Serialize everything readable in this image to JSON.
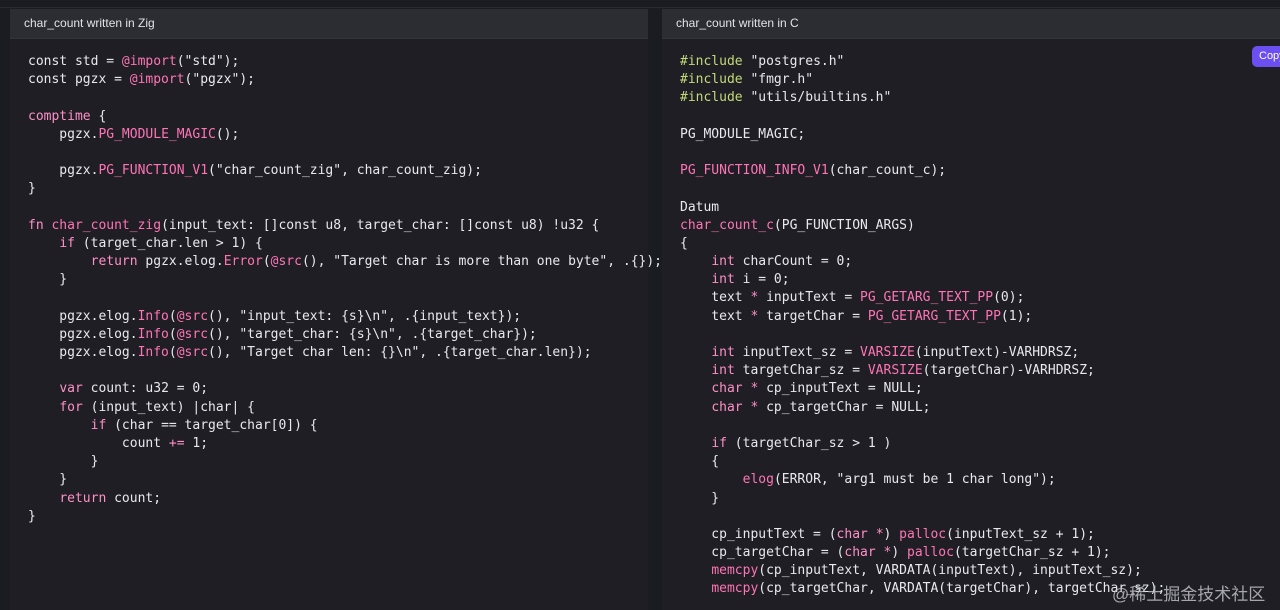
{
  "panels": {
    "zig": {
      "title": "char_count written in Zig",
      "lines": [
        [
          {
            "t": "const std = "
          },
          {
            "t": "@import",
            "c": "fn"
          },
          {
            "t": "(\"std\");"
          }
        ],
        [
          {
            "t": "const pgzx = "
          },
          {
            "t": "@import",
            "c": "fn"
          },
          {
            "t": "(\"pgzx\");"
          }
        ],
        [],
        [
          {
            "t": "comptime",
            "c": "kw"
          },
          {
            "t": " {"
          }
        ],
        [
          {
            "t": "    pgzx."
          },
          {
            "t": "PG_MODULE_MAGIC",
            "c": "fn"
          },
          {
            "t": "();"
          }
        ],
        [],
        [
          {
            "t": "    pgzx."
          },
          {
            "t": "PG_FUNCTION_V1",
            "c": "fn"
          },
          {
            "t": "(\"char_count_zig\", char_count_zig);"
          }
        ],
        [
          {
            "t": "}"
          }
        ],
        [],
        [
          {
            "t": "fn",
            "c": "kw"
          },
          {
            "t": " "
          },
          {
            "t": "char_count_zig",
            "c": "fn"
          },
          {
            "t": "(input_text: []const u8, target_char: []const u8) !u32 {"
          }
        ],
        [
          {
            "t": "    "
          },
          {
            "t": "if",
            "c": "kw"
          },
          {
            "t": " (target_char.len > 1) {"
          }
        ],
        [
          {
            "t": "        "
          },
          {
            "t": "return",
            "c": "kw"
          },
          {
            "t": " pgzx.elog."
          },
          {
            "t": "Error",
            "c": "fn"
          },
          {
            "t": "("
          },
          {
            "t": "@src",
            "c": "fn"
          },
          {
            "t": "(), \"Target char is more than one byte\", .{});"
          }
        ],
        [
          {
            "t": "    }"
          }
        ],
        [],
        [
          {
            "t": "    pgzx.elog."
          },
          {
            "t": "Info",
            "c": "fn"
          },
          {
            "t": "("
          },
          {
            "t": "@src",
            "c": "fn"
          },
          {
            "t": "(), \"input_text: {s}\\n\", .{input_text});"
          }
        ],
        [
          {
            "t": "    pgzx.elog."
          },
          {
            "t": "Info",
            "c": "fn"
          },
          {
            "t": "("
          },
          {
            "t": "@src",
            "c": "fn"
          },
          {
            "t": "(), \"target_char: {s}\\n\", .{target_char});"
          }
        ],
        [
          {
            "t": "    pgzx.elog."
          },
          {
            "t": "Info",
            "c": "fn"
          },
          {
            "t": "("
          },
          {
            "t": "@src",
            "c": "fn"
          },
          {
            "t": "(), \"Target char len: {}\\n\", .{target_char.len});"
          }
        ],
        [],
        [
          {
            "t": "    "
          },
          {
            "t": "var",
            "c": "kw"
          },
          {
            "t": " count: u32 = 0;"
          }
        ],
        [
          {
            "t": "    "
          },
          {
            "t": "for",
            "c": "kw"
          },
          {
            "t": " (input_text) |char| {"
          }
        ],
        [
          {
            "t": "        "
          },
          {
            "t": "if",
            "c": "kw"
          },
          {
            "t": " (char == target_char[0]) {"
          }
        ],
        [
          {
            "t": "            count "
          },
          {
            "t": "+=",
            "c": "op"
          },
          {
            "t": " 1;"
          }
        ],
        [
          {
            "t": "        }"
          }
        ],
        [
          {
            "t": "    }"
          }
        ],
        [
          {
            "t": "    "
          },
          {
            "t": "return",
            "c": "kw"
          },
          {
            "t": " count;"
          }
        ],
        [
          {
            "t": "}"
          }
        ]
      ]
    },
    "c": {
      "title": "char_count written in C",
      "copy_label": "Copy",
      "lines": [
        [
          {
            "t": "#include",
            "c": "pre"
          },
          {
            "t": " \"postgres.h\""
          }
        ],
        [
          {
            "t": "#include",
            "c": "pre"
          },
          {
            "t": " \"fmgr.h\""
          }
        ],
        [
          {
            "t": "#include",
            "c": "pre"
          },
          {
            "t": " \"utils/builtins.h\""
          }
        ],
        [],
        [
          {
            "t": "PG_MODULE_MAGIC;"
          }
        ],
        [],
        [
          {
            "t": "PG_FUNCTION_INFO_V1",
            "c": "fn"
          },
          {
            "t": "(char_count_c);"
          }
        ],
        [],
        [
          {
            "t": "Datum"
          }
        ],
        [
          {
            "t": "char_count_c",
            "c": "fn"
          },
          {
            "t": "(PG_FUNCTION_ARGS)"
          }
        ],
        [
          {
            "t": "{"
          }
        ],
        [
          {
            "t": "    "
          },
          {
            "t": "int",
            "c": "kw"
          },
          {
            "t": " charCount = 0;"
          }
        ],
        [
          {
            "t": "    "
          },
          {
            "t": "int",
            "c": "kw"
          },
          {
            "t": " i = 0;"
          }
        ],
        [
          {
            "t": "    text "
          },
          {
            "t": "*",
            "c": "op"
          },
          {
            "t": " inputText = "
          },
          {
            "t": "PG_GETARG_TEXT_PP",
            "c": "fn"
          },
          {
            "t": "(0);"
          }
        ],
        [
          {
            "t": "    text "
          },
          {
            "t": "*",
            "c": "op"
          },
          {
            "t": " targetChar = "
          },
          {
            "t": "PG_GETARG_TEXT_PP",
            "c": "fn"
          },
          {
            "t": "(1);"
          }
        ],
        [],
        [
          {
            "t": "    "
          },
          {
            "t": "int",
            "c": "kw"
          },
          {
            "t": " inputText_sz = "
          },
          {
            "t": "VARSIZE",
            "c": "fn"
          },
          {
            "t": "(inputText)-VARHDRSZ;"
          }
        ],
        [
          {
            "t": "    "
          },
          {
            "t": "int",
            "c": "kw"
          },
          {
            "t": " targetChar_sz = "
          },
          {
            "t": "VARSIZE",
            "c": "fn"
          },
          {
            "t": "(targetChar)-VARHDRSZ;"
          }
        ],
        [
          {
            "t": "    "
          },
          {
            "t": "char",
            "c": "kw"
          },
          {
            "t": " "
          },
          {
            "t": "*",
            "c": "op"
          },
          {
            "t": " cp_inputText = NULL;"
          }
        ],
        [
          {
            "t": "    "
          },
          {
            "t": "char",
            "c": "kw"
          },
          {
            "t": " "
          },
          {
            "t": "*",
            "c": "op"
          },
          {
            "t": " cp_targetChar = NULL;"
          }
        ],
        [],
        [
          {
            "t": "    "
          },
          {
            "t": "if",
            "c": "kw"
          },
          {
            "t": " (targetChar_sz > 1 )"
          }
        ],
        [
          {
            "t": "    {"
          }
        ],
        [
          {
            "t": "        "
          },
          {
            "t": "elog",
            "c": "fn"
          },
          {
            "t": "(ERROR, \"arg1 must be 1 char long\");"
          }
        ],
        [
          {
            "t": "    }"
          }
        ],
        [],
        [
          {
            "t": "    cp_inputText = ("
          },
          {
            "t": "char",
            "c": "kw"
          },
          {
            "t": " "
          },
          {
            "t": "*",
            "c": "op"
          },
          {
            "t": ") "
          },
          {
            "t": "palloc",
            "c": "fn"
          },
          {
            "t": "(inputText_sz + 1);"
          }
        ],
        [
          {
            "t": "    cp_targetChar = ("
          },
          {
            "t": "char",
            "c": "kw"
          },
          {
            "t": " "
          },
          {
            "t": "*",
            "c": "op"
          },
          {
            "t": ") "
          },
          {
            "t": "palloc",
            "c": "fn"
          },
          {
            "t": "(targetChar_sz + 1);"
          }
        ],
        [
          {
            "t": "    "
          },
          {
            "t": "memcpy",
            "c": "fn"
          },
          {
            "t": "(cp_inputText, VARDATA(inputText), inputText_sz);"
          }
        ],
        [
          {
            "t": "    "
          },
          {
            "t": "memcpy",
            "c": "fn"
          },
          {
            "t": "(cp_targetChar, VARDATA(targetChar), targetChar_sz);"
          }
        ]
      ]
    }
  },
  "watermark": "@稀土掘金技术社区",
  "colors": {
    "accent": "#6b4ff0",
    "keyword": "#ff8fc7",
    "function": "#ff74b5",
    "preprocessor": "#c4d979"
  }
}
